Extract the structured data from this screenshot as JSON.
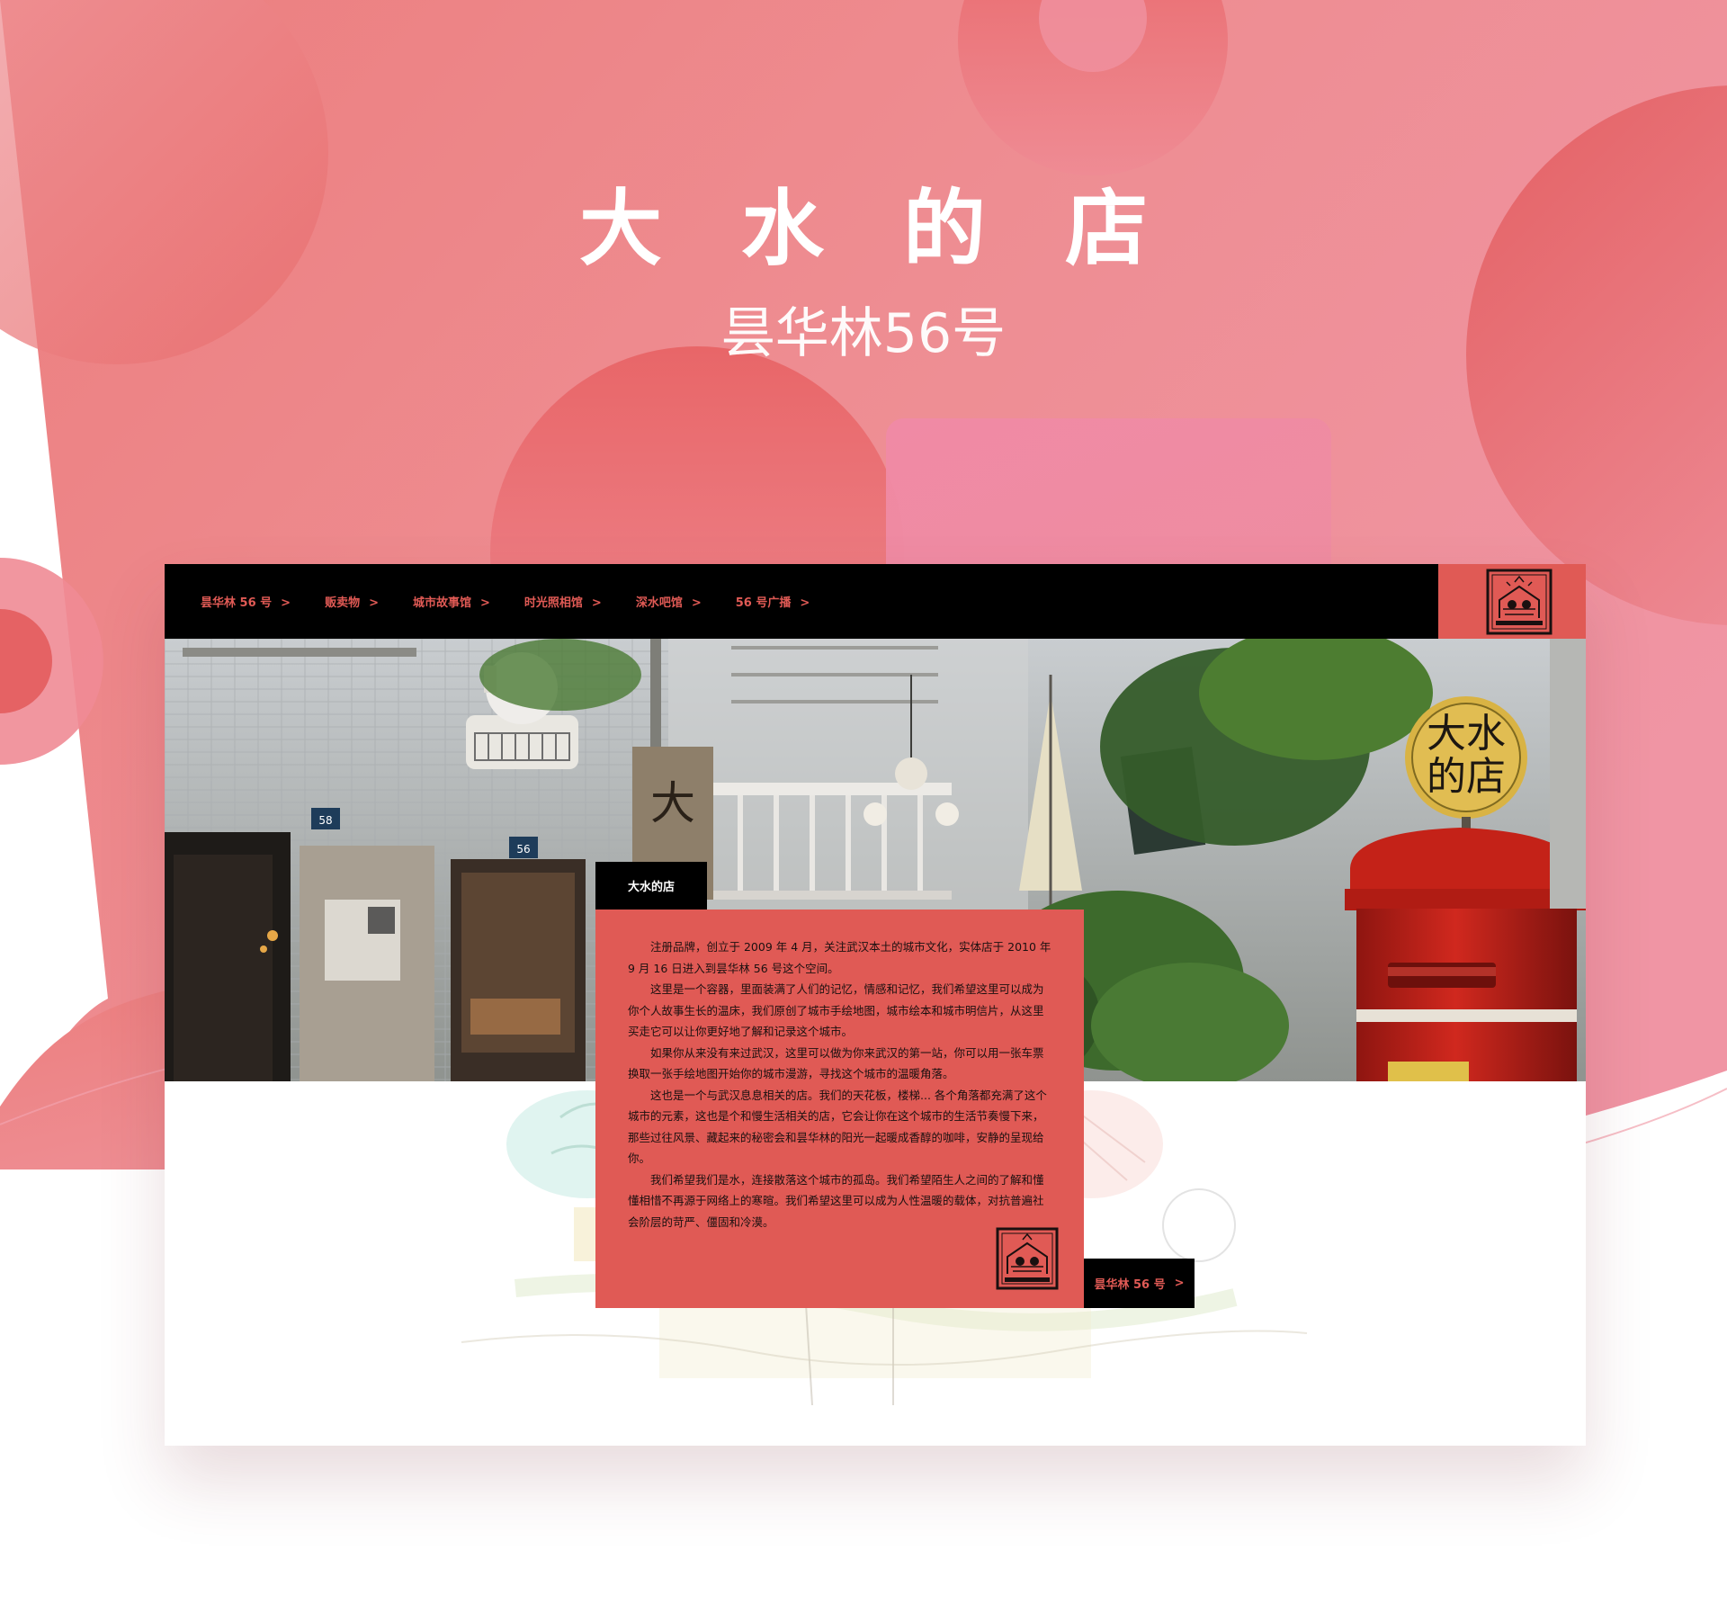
{
  "hero": {
    "title": "大 水 的 店",
    "subtitle": "昙华林56号"
  },
  "nav": {
    "items": [
      {
        "label": "昙华林 56 号",
        "chevron": ">"
      },
      {
        "label": "贩卖物",
        "chevron": ">"
      },
      {
        "label": "城市故事馆",
        "chevron": ">"
      },
      {
        "label": "时光照相馆",
        "chevron": ">"
      },
      {
        "label": "深水吧馆",
        "chevron": ">"
      },
      {
        "label": "56 号广播",
        "chevron": ">"
      }
    ]
  },
  "intro": {
    "tag": "大水的店",
    "paragraphs": [
      "注册品牌，创立于 2009 年 4 月，关注武汉本土的城市文化，实体店于 2010 年 9 月 16 日进入到昙华林 56 号这个空间。",
      "这里是一个容器，里面装满了人们的记忆，情感和记忆，我们希望这里可以成为你个人故事生长的温床，我们原创了城市手绘地图，城市绘本和城市明信片，从这里买走它可以让你更好地了解和记录这个城市。",
      "如果你从来没有来过武汉，这里可以做为你来武汉的第一站，你可以用一张车票换取一张手绘地图开始你的城市漫游，寻找这个城市的温暖角落。",
      "这也是一个与武汉息息相关的店。我们的天花板，楼梯... 各个角落都充满了这个城市的元素，这也是个和慢生活相关的店，它会让你在这个城市的生活节奏慢下来，那些过往风景、藏起来的秘密会和昙华林的阳光一起暖成香醇的咖啡，安静的呈现给你。",
      "我们希望我们是水，连接散落这个城市的孤岛。我们希望陌生人之间的了解和懂懂相惜不再源于网络上的寒暄。我们希望这里可以成为人性温暖的载体，对抗普遍社会阶层的苛严、僵固和冷漠。"
    ],
    "more_link": {
      "label": "昙华林 56 号",
      "chevron": ">"
    }
  },
  "photo": {
    "sign_text": [
      "大水",
      "的店"
    ],
    "door_numbers": [
      "58",
      "56"
    ]
  },
  "colors": {
    "accent": "#e05a55",
    "nav_bg": "#000000",
    "hero_pink": "#ef8a98"
  }
}
